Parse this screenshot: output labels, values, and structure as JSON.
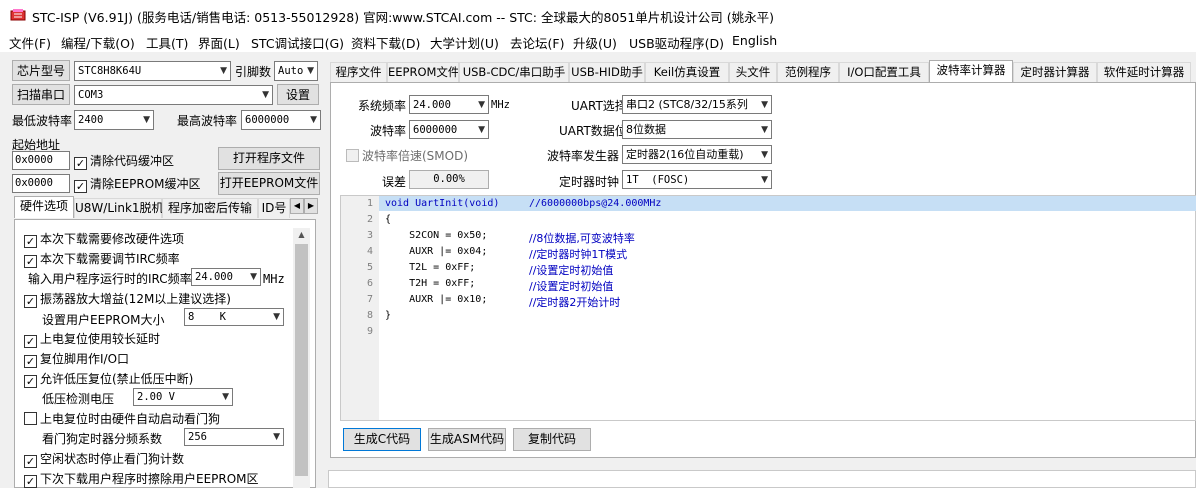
{
  "window": {
    "title": "STC-ISP (V6.91J) (服务电话/销售电话: 0513-55012928) 官网:www.STCAI.com  -- STC: 全球最大的8051单片机设计公司 (姚永平)",
    "icon": "app-icon"
  },
  "menu": [
    {
      "label": "文件(F)"
    },
    {
      "label": "编程/下载(O)"
    },
    {
      "label": "工具(T)"
    },
    {
      "label": "界面(L)"
    },
    {
      "label": "STC调试接口(G)"
    },
    {
      "label": "资料下载(D)"
    },
    {
      "label": "大学计划(U)"
    },
    {
      "label": "去论坛(F)"
    },
    {
      "label": "升级(U)"
    },
    {
      "label": "USB驱动程序(D)"
    },
    {
      "label": "English"
    }
  ],
  "left": {
    "chip_label": "芯片型号",
    "chip_value": "STC8H8K64U",
    "pin_label": "引脚数",
    "pin_value": "Auto",
    "scan_label": "扫描串口",
    "port_value": "COM3",
    "settings_label": "设置",
    "min_baud_label": "最低波特率",
    "min_baud_value": "2400",
    "max_baud_label": "最高波特率",
    "max_baud_value": "6000000",
    "start_addr_label": "起始地址",
    "addr1_value": "0x0000",
    "clear_code_label": "清除代码缓冲区",
    "open_prog_label": "打开程序文件",
    "addr2_value": "0x0000",
    "clear_eeprom_label": "清除EEPROM缓冲区",
    "open_eeprom_label": "打开EEPROM文件",
    "tabs": [
      "硬件选项",
      "U8W/Link1脱机",
      "程序加密后传输",
      "ID号"
    ],
    "options": [
      {
        "label": "本次下载需要修改硬件选项",
        "checked": "✓"
      },
      {
        "label": "本次下载需要调节IRC频率",
        "checked": "✓"
      },
      {
        "label": "输入用户程序运行时的IRC频率",
        "value": "24.000",
        "unit": "MHz"
      },
      {
        "label": "振荡器放大增益(12M以上建议选择)",
        "checked": "✓"
      },
      {
        "label": "设置用户EEPROM大小",
        "value": "8    K"
      },
      {
        "label": "上电复位使用较长延时",
        "checked": "✓"
      },
      {
        "label": "复位脚用作I/O口",
        "checked": "✓"
      },
      {
        "label": "允许低压复位(禁止低压中断)",
        "checked": "✓"
      },
      {
        "label": "低压检测电压",
        "value": "2.00 V"
      },
      {
        "label": "上电复位时由硬件自动启动看门狗",
        "checked": ""
      },
      {
        "label": "看门狗定时器分频系数",
        "value": "256"
      },
      {
        "label": "空闲状态时停止看门狗计数",
        "checked": "✓"
      },
      {
        "label": "下次下载用户程序时擦除用户EEPROM区",
        "checked": "✓"
      }
    ]
  },
  "right": {
    "tabs": [
      "程序文件",
      "EEPROM文件",
      "USB-CDC/串口助手",
      "USB-HID助手",
      "Keil仿真设置",
      "头文件",
      "范例程序",
      "I/O口配置工具",
      "波特率计算器",
      "定时器计算器",
      "软件延时计算器"
    ],
    "active_tab_index": 8,
    "sys_freq_label": "系统频率",
    "sys_freq_value": "24.000",
    "sys_freq_unit": "MHz",
    "baud_label": "波特率",
    "baud_value": "6000000",
    "smod_label": "波特率倍速(SMOD)",
    "error_label": "误差",
    "error_value": "0.00%",
    "uart_sel_label": "UART选择",
    "uart_sel_value": "串口2 (STC8/32/15系列",
    "uart_bits_label": "UART数据位",
    "uart_bits_value": "8位数据",
    "baud_gen_label": "波特率发生器",
    "baud_gen_value": "定时器2(16位自动重载)",
    "timer_clk_label": "定时器时钟",
    "timer_clk_value": "1T  (FOSC)",
    "code_lines": [
      {
        "num": "1",
        "code": "void UartInit(void)",
        "comment": "//6000000bps@24.000MHz"
      },
      {
        "num": "2",
        "code": "{",
        "comment": ""
      },
      {
        "num": "3",
        "code": "    S2CON = 0x50;",
        "comment": "//8位数据,可变波特率"
      },
      {
        "num": "4",
        "code": "    AUXR |= 0x04;",
        "comment": "//定时器时钟1T模式"
      },
      {
        "num": "5",
        "code": "    T2L = 0xFF;",
        "comment": "//设置定时初始值"
      },
      {
        "num": "6",
        "code": "    T2H = 0xFF;",
        "comment": "//设置定时初始值"
      },
      {
        "num": "7",
        "code": "    AUXR |= 0x10;",
        "comment": "//定时器2开始计时"
      },
      {
        "num": "8",
        "code": "}",
        "comment": ""
      },
      {
        "num": "9",
        "code": "",
        "comment": ""
      }
    ],
    "gen_c_label": "生成C代码",
    "gen_asm_label": "生成ASM代码",
    "copy_label": "复制代码"
  }
}
